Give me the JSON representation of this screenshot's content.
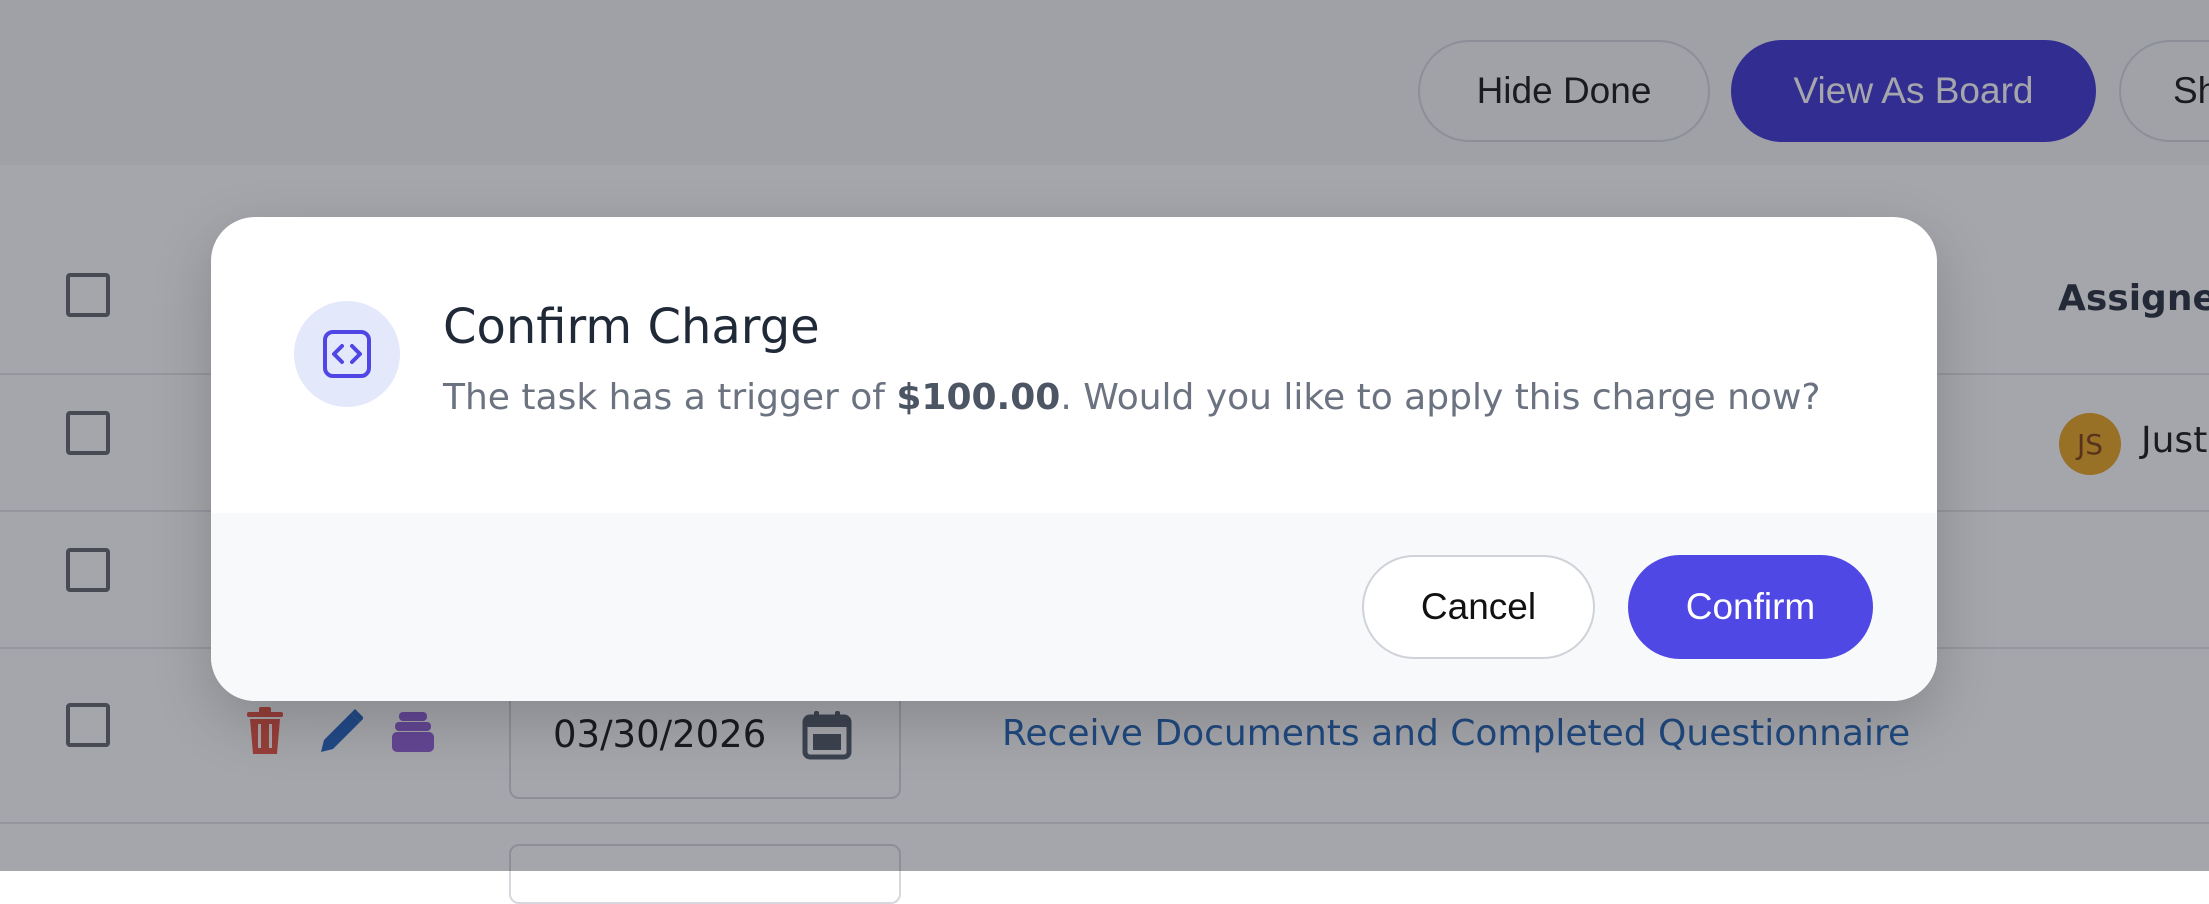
{
  "toolbar": {
    "hide_done_label": "Hide Done",
    "view_as_board_label": "View As Board",
    "partial_button_label": "Sh"
  },
  "table": {
    "assigned_header": "Assigned",
    "rows": [
      {
        "assignee_initials": "JS",
        "assignee_name": "Just"
      },
      {
        "date": "03/30/2026",
        "task": "Receive Documents and Completed Questionnaire"
      }
    ]
  },
  "modal": {
    "title": "Confirm Charge",
    "message_prefix": "The task has a trigger of ",
    "amount": "$100.00",
    "message_suffix": ". Would you like to apply this charge now?",
    "cancel_label": "Cancel",
    "confirm_label": "Confirm"
  },
  "icons": {
    "modal_icon": "code-brackets-icon",
    "delete": "trash-icon",
    "edit": "pencil-icon",
    "stack": "stack-icon",
    "calendar": "calendar-icon"
  },
  "colors": {
    "primary": "#5048e5",
    "primary_dark": "#3a2fd0",
    "link": "#1a5fb4",
    "avatar_bg": "#e9a21a",
    "delete_icon": "#e74c3c",
    "edit_icon": "#1e5fbf",
    "stack_icon": "#8e5bd6"
  }
}
